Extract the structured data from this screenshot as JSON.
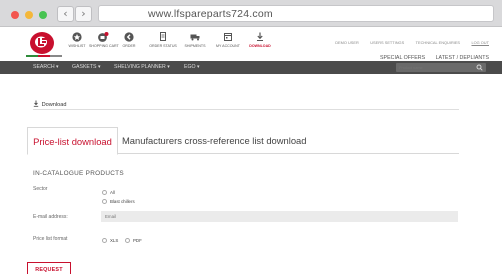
{
  "browser": {
    "url": "www.lfspareparts724.com",
    "back_glyph": "‹",
    "forward_glyph": "›"
  },
  "header": {
    "icons": [
      {
        "label": "Wishlist",
        "icon": "star-icon",
        "highlight": false
      },
      {
        "label": "Shopping cart",
        "icon": "cart-icon",
        "highlight": false
      },
      {
        "label": "Order",
        "icon": "arrow-circle-icon",
        "highlight": false
      },
      {
        "label": "Order status",
        "icon": "document-icon",
        "highlight": false
      },
      {
        "label": "Shipments",
        "icon": "truck-icon",
        "highlight": false
      },
      {
        "label": "My account",
        "icon": "calendar-icon",
        "highlight": false
      },
      {
        "label": "Download",
        "icon": "download-icon",
        "highlight": true
      }
    ],
    "top_links": [
      "Demo user",
      "Users settings",
      "Technical enquiries",
      "Log out"
    ],
    "offer_links": [
      "SPECIAL OFFERS",
      "LATEST / DEPLIANTS"
    ]
  },
  "nav": {
    "items": [
      "SEARCH ▾",
      "GASKETS ▾",
      "SHELVING PLANNER ▾",
      "EGO ▾"
    ],
    "search_placeholder": "Product name"
  },
  "breadcrumb": {
    "download_label": "Download"
  },
  "tabs": {
    "active": "Price-list download",
    "inactive": "Manufacturers cross-reference list download"
  },
  "form": {
    "section_title": "IN-CATALOGUE PRODUCTS",
    "sector_label": "Sector",
    "sector_options": [
      "All",
      "Blast chillers"
    ],
    "email_label": "E-mail address:",
    "email_placeholder": "Email",
    "format_label": "Price list format",
    "format_options": [
      "XLS",
      "PDF"
    ],
    "submit_label": "REQUEST"
  },
  "colors": {
    "brand_red": "#c8102e",
    "nav_bg": "#4b4b4b"
  }
}
